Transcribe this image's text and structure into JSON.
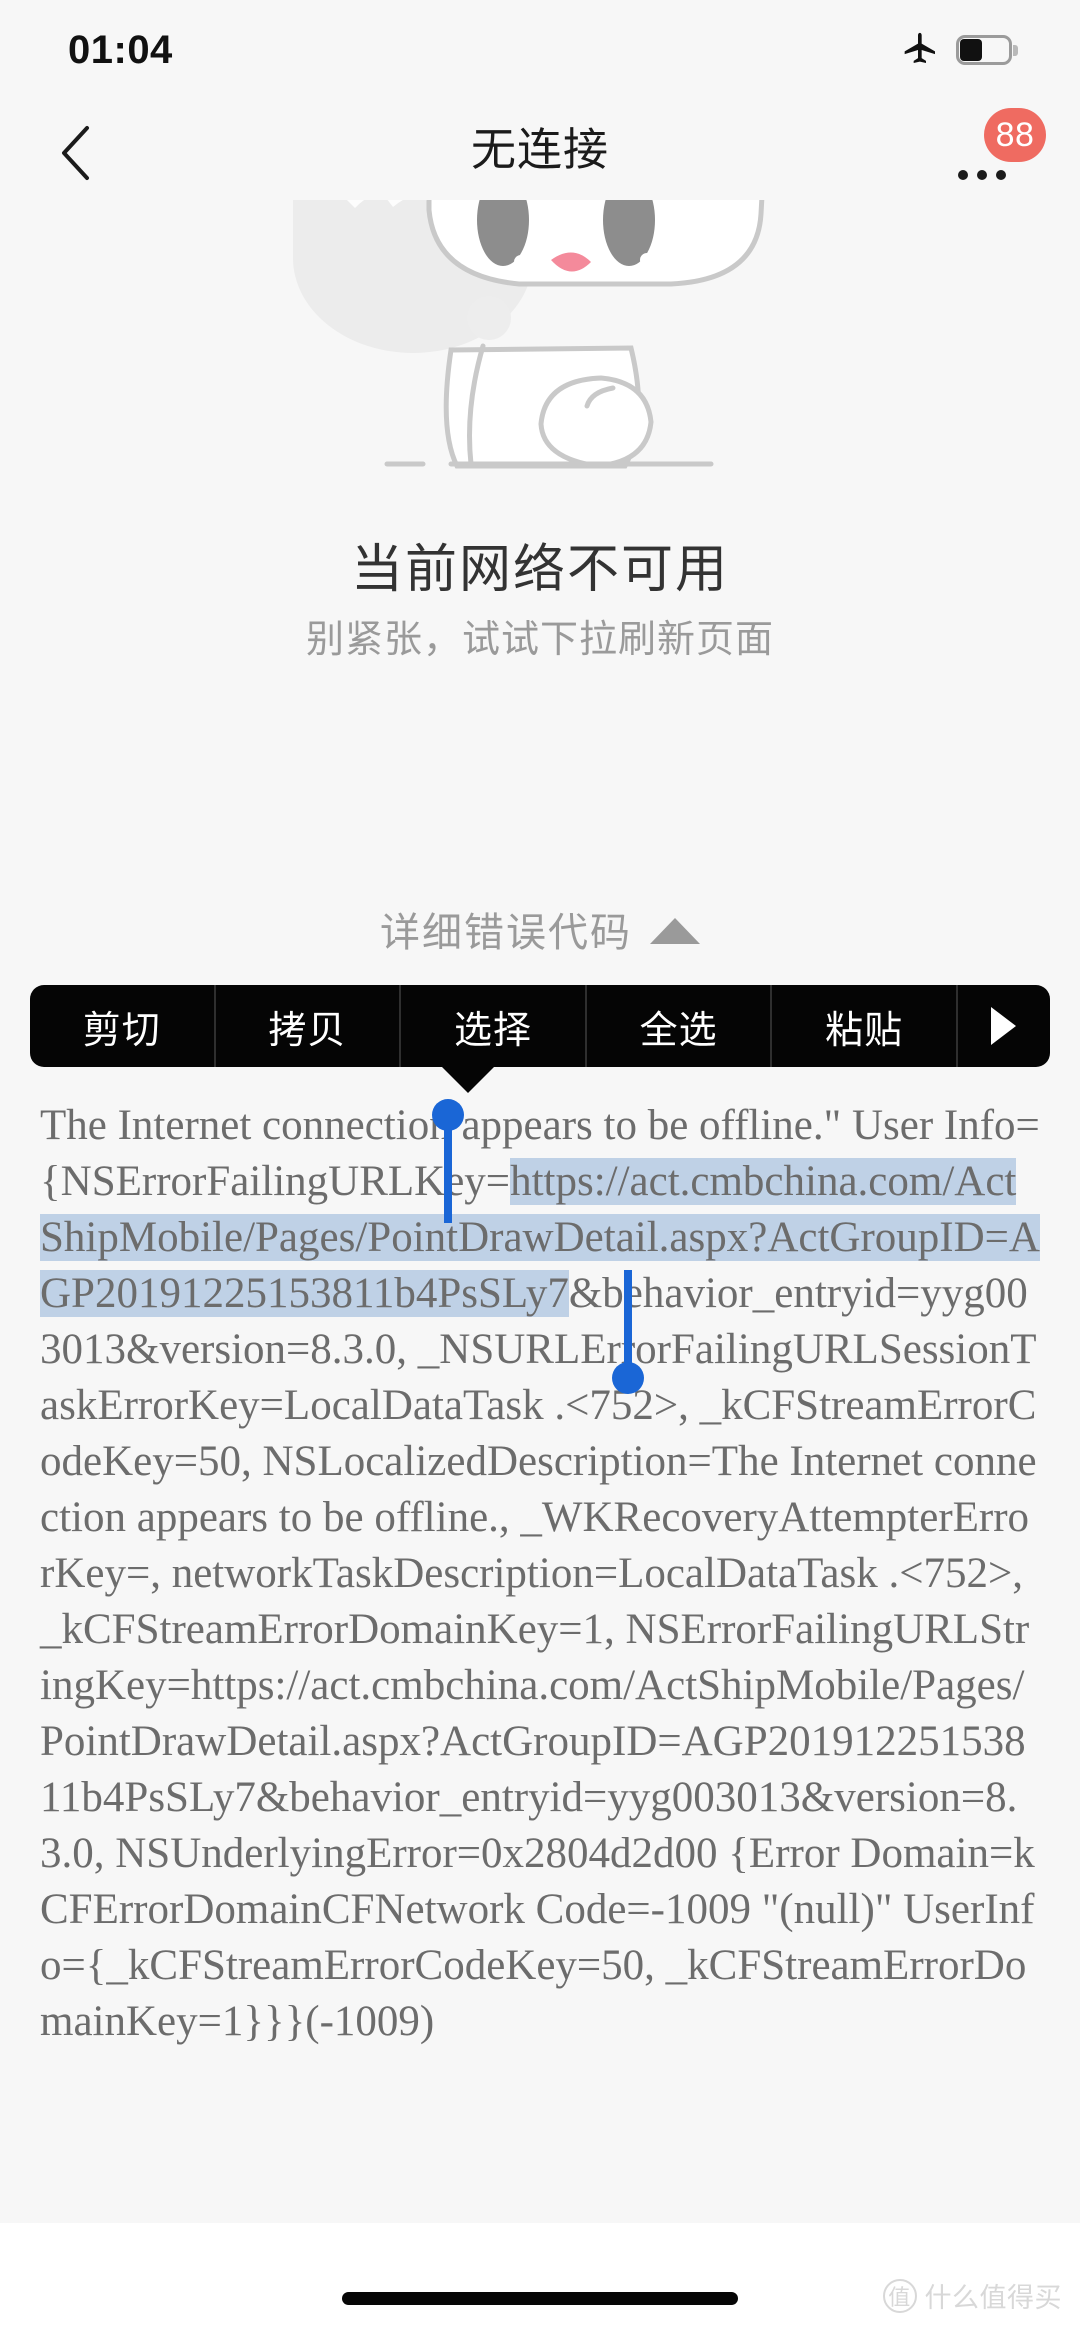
{
  "status_bar": {
    "time": "01:04",
    "airplane_icon": "airplane-mode-icon",
    "battery_icon": "battery-icon"
  },
  "nav_bar": {
    "back_icon": "back-chevron-icon",
    "title": "无连接",
    "more_icon": "more-options-icon",
    "badge_count": "88"
  },
  "illustration": {
    "name": "offline-cat-illustration",
    "body_color": "#ffffff",
    "outline_color": "#c9c9c9",
    "eye_color": "#8d8d8d",
    "nose_color": "#f48a9b",
    "bowl_color": "#ebebeb"
  },
  "empty_state": {
    "title": "当前网络不可用",
    "subtitle": "别紧张，试试下拉刷新页面"
  },
  "detail_toggle": {
    "label": "详细错误代码",
    "icon": "triangle-up-icon",
    "expanded": true
  },
  "context_menu": {
    "items": [
      {
        "label": "剪切",
        "name": "cut"
      },
      {
        "label": "拷贝",
        "name": "copy"
      },
      {
        "label": "选择",
        "name": "select"
      },
      {
        "label": "全选",
        "name": "select-all"
      },
      {
        "label": "粘贴",
        "name": "paste"
      }
    ],
    "more_icon": "triangle-right-icon",
    "background": "#050505"
  },
  "error_detail": {
    "selection_color": "#bfd1e6",
    "handle_color": "#1a66d6",
    "segments": [
      {
        "text": "The Internet connection appears to be offline.\" User Info={NSErrorFailingURLKey=",
        "selected": false
      },
      {
        "text": "https://act.cmbchina.com/ActShipMobile/Pages/PointDrawDetail.aspx?ActGroupID=AGP20191225153811b4PsSLy7",
        "selected": true
      },
      {
        "text": "&behavior_entryid=yyg003013&version=8.3.0, _NSURLErrorFailingURLSessionTaskErrorKey=LocalDataTask .<752>, _kCFStreamErrorCodeKey=50, NSLocalizedDescription=The Internet connection appears to be offline., _WKRecoveryAttempterErrorKey=, networkTaskDescription=LocalDataTask .<752>, _kCFStreamErrorDomainKey=1, NSErrorFailingURLStringKey=https://act.cmbchina.com/ActShipMobile/Pages/PointDrawDetail.aspx?ActGroupID=AGP20191225153811b4PsSLy7&behavior_entryid=yyg003013&version=8.3.0, NSUnderlyingError=0x2804d2d00 {Error Domain=kCFErrorDomainCFNetwork Code=-1009 \"(null)\" UserInfo={_kCFStreamErrorCodeKey=50, _kCFStreamErrorDomainKey=1}}}(-1009)",
        "selected": false
      }
    ]
  },
  "bottom": {
    "home_indicator": "home-indicator",
    "watermark_text": "什么值得买",
    "watermark_logo": "值"
  }
}
